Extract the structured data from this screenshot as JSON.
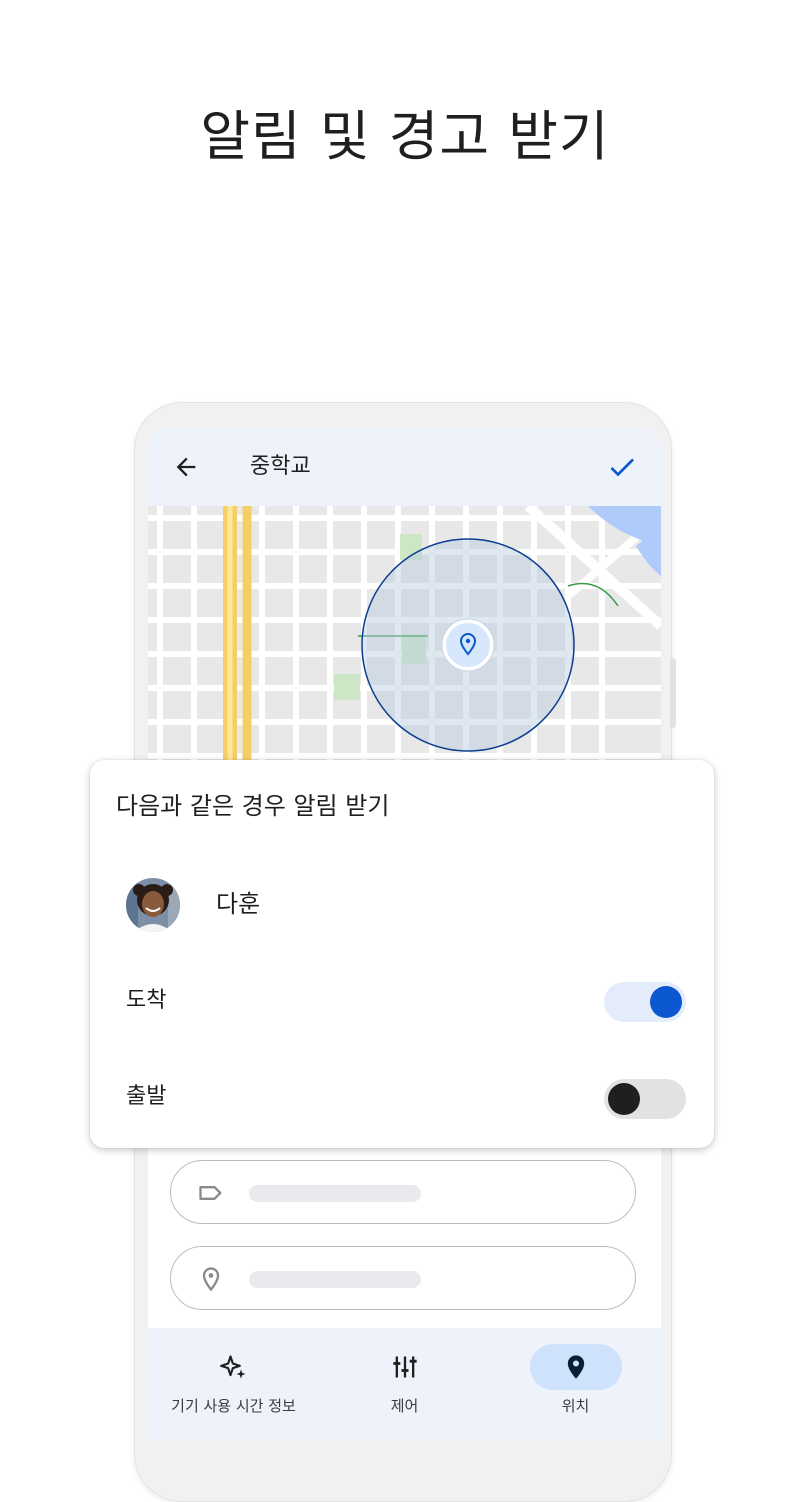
{
  "headline": "알림 및 경고 받기",
  "appbar": {
    "title": "중학교"
  },
  "card": {
    "title": "다음과 같은 경우 알림 받기",
    "child_name": "다훈",
    "arrive": {
      "label": "도착",
      "on": true
    },
    "depart": {
      "label": "출발",
      "on": false
    }
  },
  "bottom_nav": [
    {
      "label": "기기 사용 시간 정보",
      "icon": "sparkle-icon",
      "active": false
    },
    {
      "label": "제어",
      "icon": "tune-icon",
      "active": false
    },
    {
      "label": "위치",
      "icon": "location-pin-icon",
      "active": true
    }
  ],
  "colors": {
    "accent": "#0b57d0",
    "appbar_bg": "#eef2fb",
    "nav_active": "#cfe2fb",
    "geofence": "#0b3d91"
  }
}
